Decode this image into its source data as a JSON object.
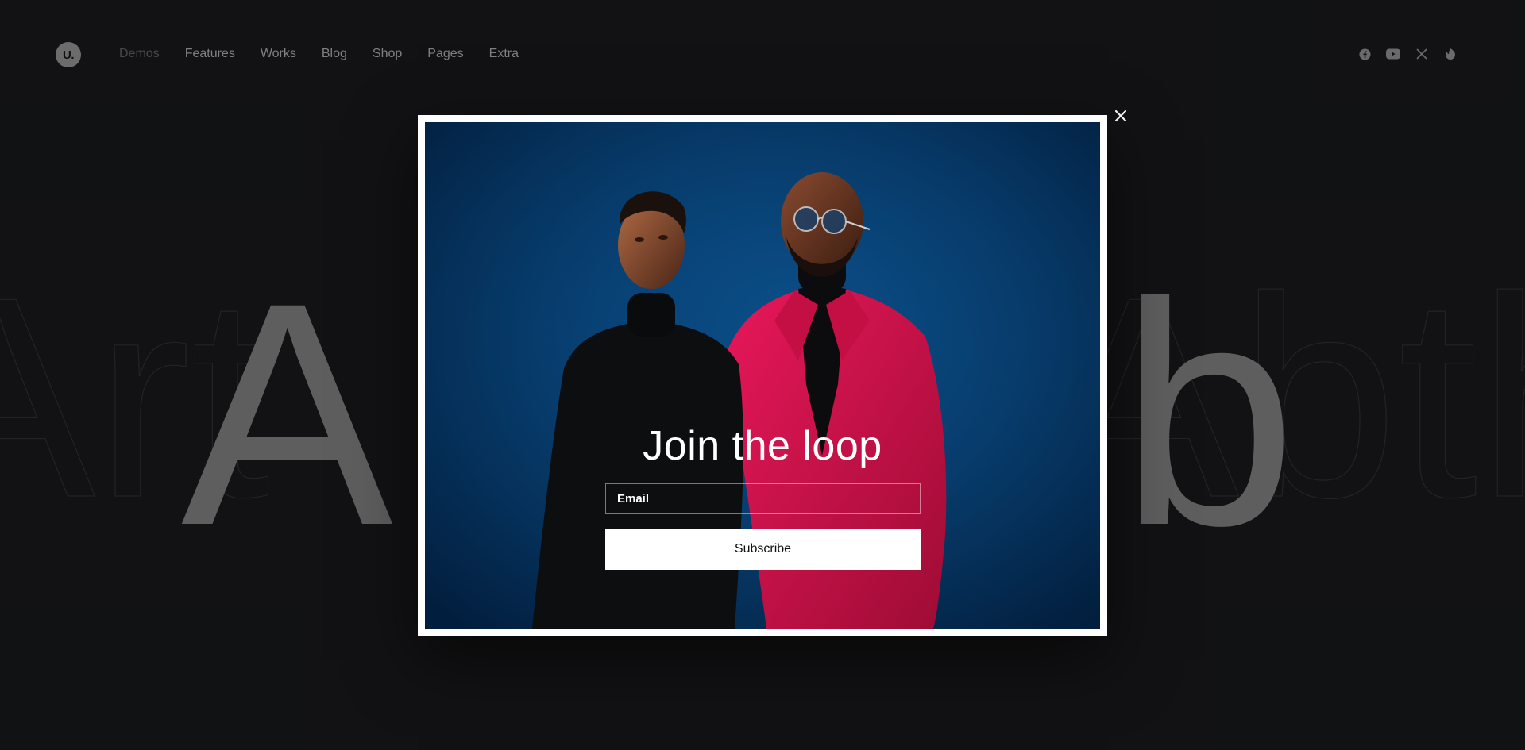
{
  "header": {
    "logo_text": "U.",
    "nav": [
      {
        "label": "Demos"
      },
      {
        "label": "Features"
      },
      {
        "label": "Works"
      },
      {
        "label": "Blog"
      },
      {
        "label": "Shop"
      },
      {
        "label": "Pages"
      },
      {
        "label": "Extra"
      }
    ],
    "social_icons": [
      "facebook-icon",
      "youtube-icon",
      "x-icon",
      "dribbble-icon"
    ]
  },
  "hero": {
    "background_text": "Art Above All Abth"
  },
  "popup": {
    "title": "Join the loop",
    "email_placeholder": "Email",
    "subscribe_label": "Subscribe",
    "close_icon": "close-icon"
  },
  "colors": {
    "page_background": "#141517",
    "modal_frame": "#ffffff",
    "photo_background": "#073f72",
    "accent_jacket": "#d8124a"
  }
}
